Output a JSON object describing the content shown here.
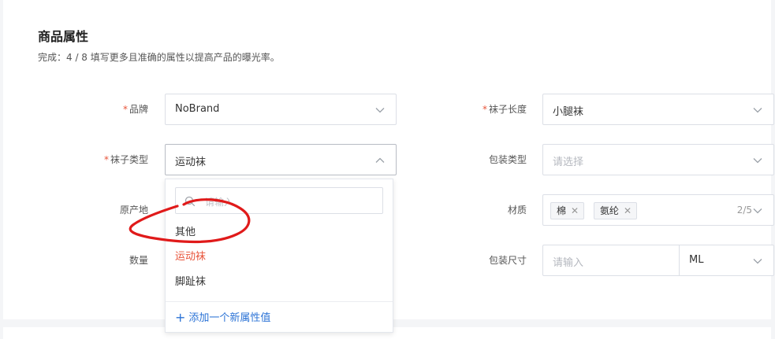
{
  "section": {
    "title": "商品属性",
    "subtitle": "完成：4 / 8 填写更多且准确的属性以提高产品的曝光率。"
  },
  "fields": {
    "brand": {
      "required": "*",
      "label": "品牌",
      "value": "NoBrand"
    },
    "sock_length": {
      "required": "*",
      "label": "袜子长度",
      "value": "小腿袜"
    },
    "sock_type": {
      "required": "*",
      "label": "袜子类型",
      "value": "运动袜"
    },
    "package_type": {
      "label": "包装类型",
      "placeholder": "请选择"
    },
    "origin": {
      "label": "原产地"
    },
    "material": {
      "label": "材质",
      "tags": [
        "棉",
        "氨纶"
      ],
      "count": "2/5"
    },
    "quantity": {
      "label": "数量"
    },
    "package_size": {
      "label": "包装尺寸",
      "placeholder": "请输入",
      "unit": "ML"
    }
  },
  "dropdown": {
    "search_placeholder": "请输入",
    "options": [
      "其他",
      "运动袜",
      "脚趾袜"
    ],
    "selected": "运动袜",
    "add_label": "添加一个新属性值"
  },
  "colors": {
    "required": "#e8543a",
    "selected_option": "#e8543a",
    "link": "#2b73d6",
    "annotation": "#e01a1a"
  }
}
